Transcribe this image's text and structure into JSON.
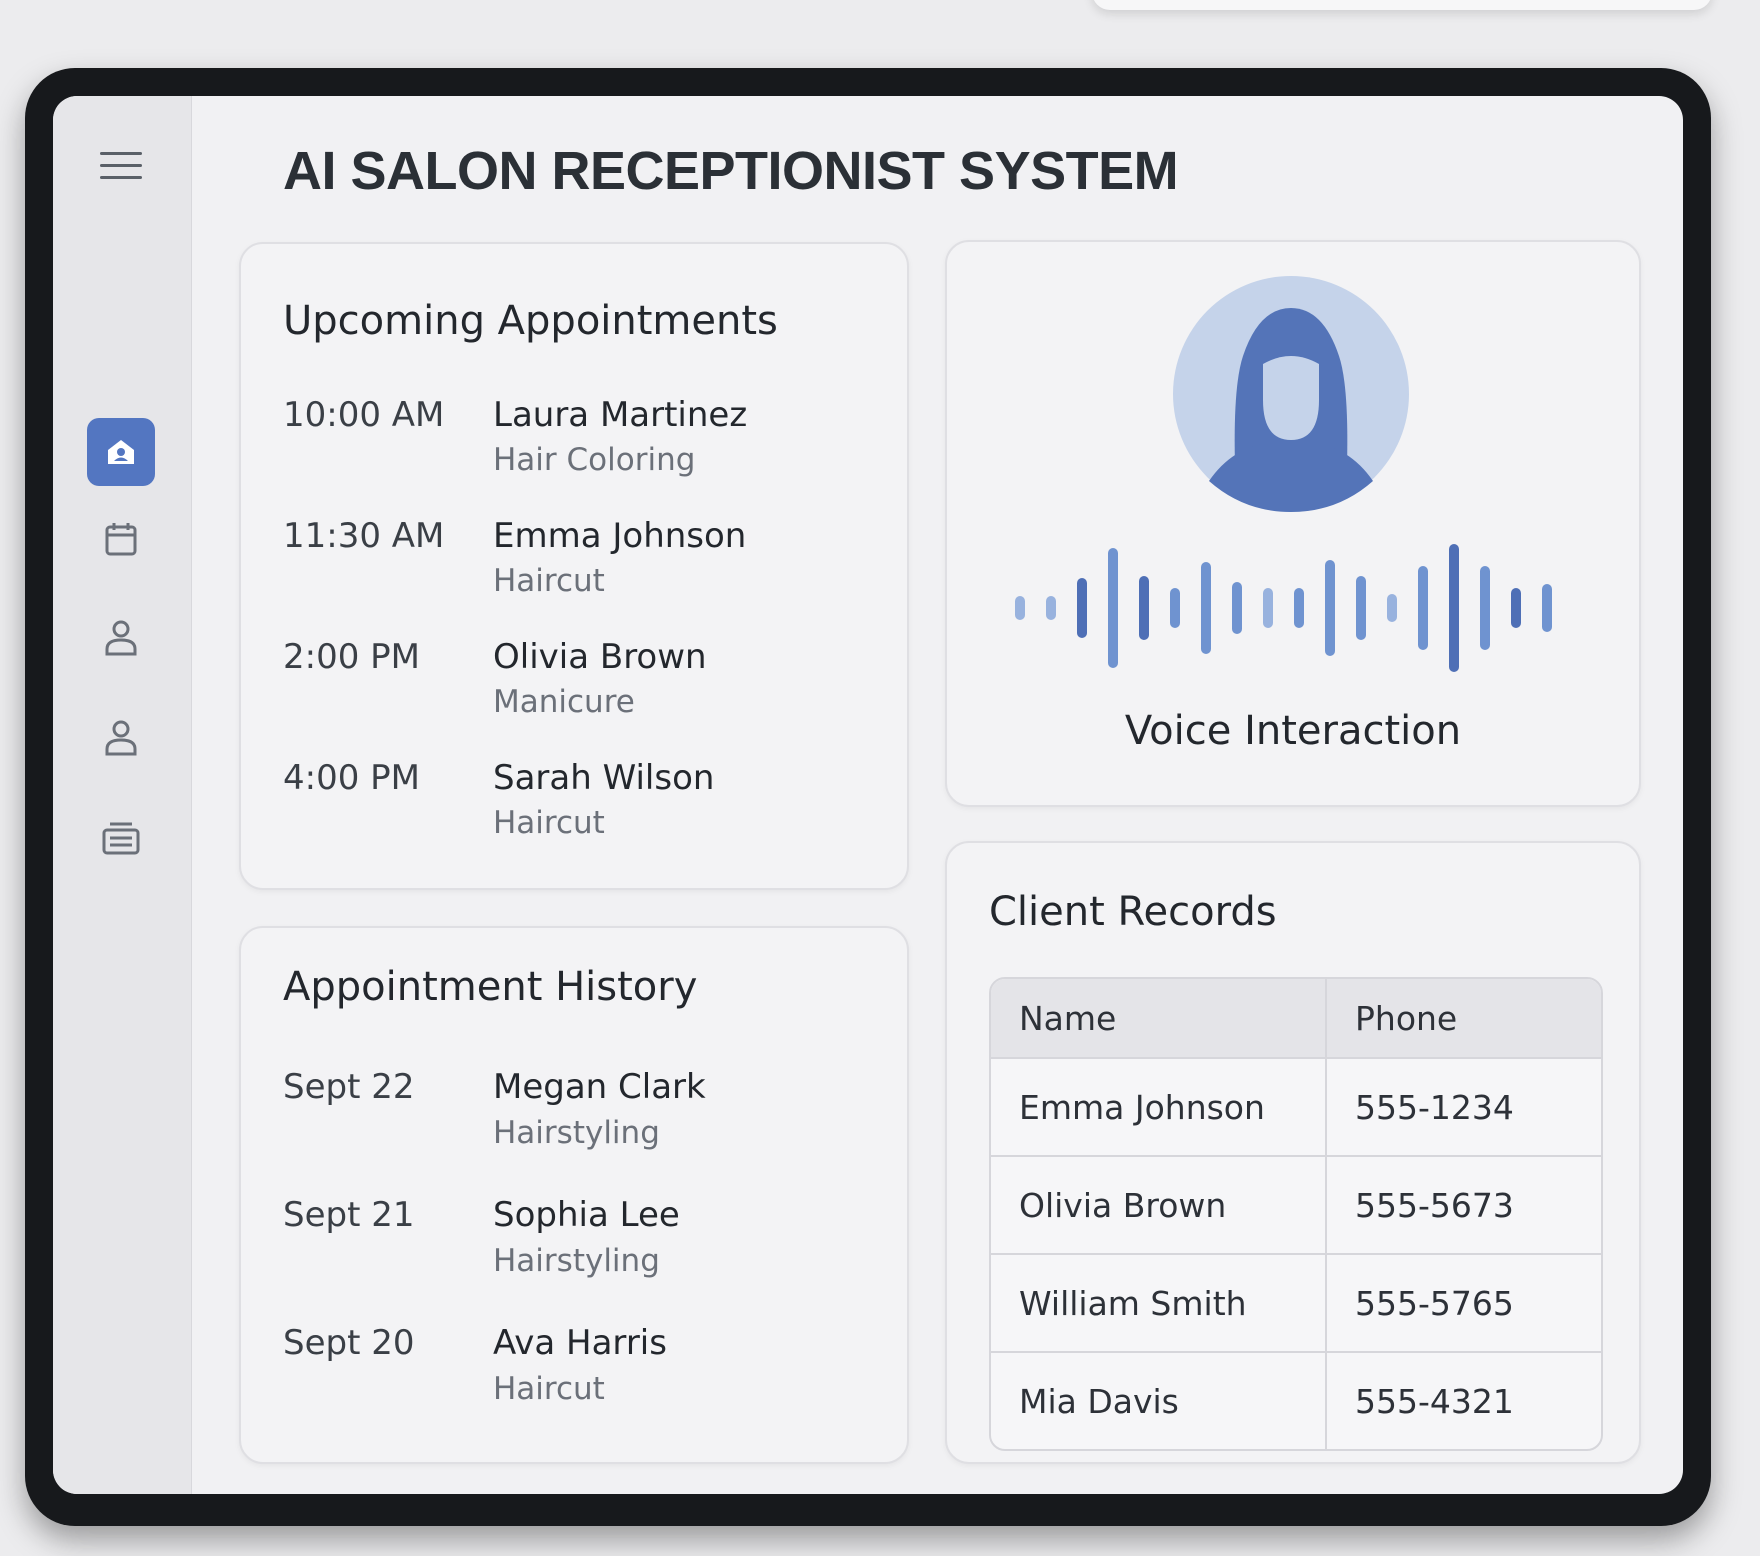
{
  "app": {
    "title": "AI SALON RECEPTIONIST SYSTEM"
  },
  "sidebar": {
    "items": [
      {
        "icon": "menu-icon"
      },
      {
        "icon": "home-icon",
        "active": true
      },
      {
        "icon": "calendar-icon"
      },
      {
        "icon": "user-icon"
      },
      {
        "icon": "user-icon"
      },
      {
        "icon": "list-icon"
      }
    ]
  },
  "upcoming": {
    "title": "Upcoming Appointments",
    "items": [
      {
        "time": "10:00 AM",
        "name": "Laura Martinez",
        "service": "Hair Coloring"
      },
      {
        "time": "11:30 AM",
        "name": "Emma Johnson",
        "service": "Haircut"
      },
      {
        "time": "2:00 PM",
        "name": "Olivia Brown",
        "service": "Manicure"
      },
      {
        "time": "4:00 PM",
        "name": "Sarah Wilson",
        "service": "Haircut"
      }
    ]
  },
  "history": {
    "title": "Appointment History",
    "items": [
      {
        "date": "Sept 22",
        "name": "Megan Clark",
        "service": "Hairstyling"
      },
      {
        "date": "Sept 21",
        "name": "Sophia Lee",
        "service": "Hairstyling"
      },
      {
        "date": "Sept 20",
        "name": "Ava Harris",
        "service": "Haircut"
      }
    ]
  },
  "voice": {
    "label": "Voice Interaction",
    "avatar_icon": "woman-avatar-icon",
    "waveform_icon": "sound-wave-icon"
  },
  "clients": {
    "title": "Client Records",
    "columns": [
      "Name",
      "Phone"
    ],
    "rows": [
      [
        "Emma Johnson",
        "555-1234"
      ],
      [
        "Olivia Brown",
        "555-5673"
      ],
      [
        "William Smith",
        "555-5765"
      ],
      [
        "Mia Davis",
        "555-4321"
      ]
    ]
  },
  "colors": {
    "accent": "#5376c1",
    "accent_light": "#c5d3ea",
    "frame": "#17191c",
    "background": "#f1f1f3"
  }
}
